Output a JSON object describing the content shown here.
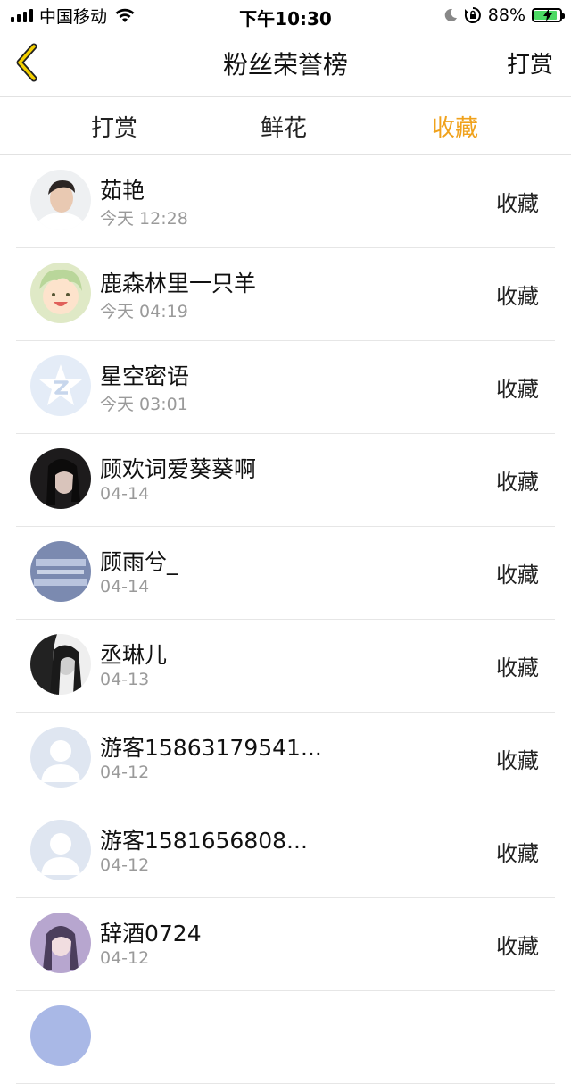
{
  "status_bar": {
    "carrier": "中国移动",
    "time": "下午10:30",
    "battery_percent": "88%",
    "battery_level": 0.88,
    "icons": [
      "signal-icon",
      "wifi-icon",
      "moon-icon",
      "orientation-lock-icon",
      "battery-charging-icon"
    ]
  },
  "nav": {
    "back_icon": "chevron-left-icon",
    "title": "粉丝荣誉榜",
    "right_label": "打赏"
  },
  "tabs": [
    {
      "label": "打赏",
      "active": false
    },
    {
      "label": "鲜花",
      "active": false
    },
    {
      "label": "收藏",
      "active": true
    }
  ],
  "accent_color": "#f0a21c",
  "list": [
    {
      "name": "茹艳",
      "time": "今天 12:28",
      "action": "收藏",
      "avatar": "photo"
    },
    {
      "name": "鹿森林里一只羊",
      "time": "今天 04:19",
      "action": "收藏",
      "avatar": "cartoon"
    },
    {
      "name": "星空密语",
      "time": "今天 03:01",
      "action": "收藏",
      "avatar": "qq-star"
    },
    {
      "name": "顾欢词爱葵葵啊",
      "time": "04-14",
      "action": "收藏",
      "avatar": "photo-dark"
    },
    {
      "name": "顾雨兮_",
      "time": "04-14",
      "action": "收藏",
      "avatar": "poster"
    },
    {
      "name": "丞琳儿",
      "time": "04-13",
      "action": "收藏",
      "avatar": "photo-bw"
    },
    {
      "name": "游客15863179541...",
      "time": "04-12",
      "action": "收藏",
      "avatar": "default-user"
    },
    {
      "name": "游客1581656808...",
      "time": "04-12",
      "action": "收藏",
      "avatar": "default-user"
    },
    {
      "name": "辞酒0724",
      "time": "04-12",
      "action": "收藏",
      "avatar": "photo-purple"
    },
    {
      "name": "",
      "time": "",
      "action": "",
      "avatar": "partial"
    }
  ]
}
